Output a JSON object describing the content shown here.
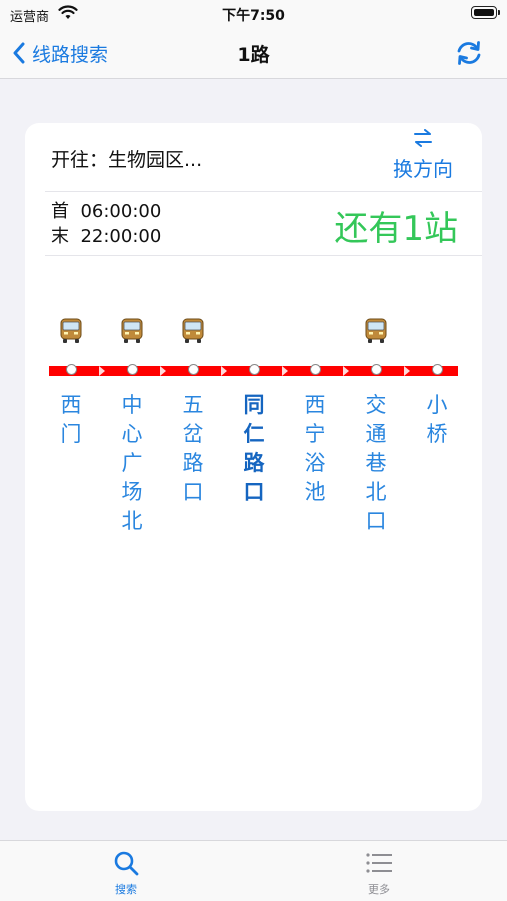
{
  "status_bar": {
    "carrier": "运营商",
    "time": "下午7:50"
  },
  "nav": {
    "back_label": "线路搜索",
    "title": "1路"
  },
  "card": {
    "destination": "开往：生物园区...",
    "switch_label": "换方向",
    "first_bus": "首  06:00:00",
    "last_bus": "末  22:00:00",
    "remaining": "还有1站"
  },
  "route": {
    "stops": [
      {
        "name": "西门",
        "chars": [
          "西",
          "门"
        ],
        "current": false,
        "bus": true
      },
      {
        "name": "中心广场北",
        "chars": [
          "中",
          "心",
          "广",
          "场",
          "北"
        ],
        "current": false,
        "bus": true
      },
      {
        "name": "五岔路口",
        "chars": [
          "五",
          "岔",
          "路",
          "口"
        ],
        "current": false,
        "bus": true
      },
      {
        "name": "同仁路口",
        "chars": [
          "同",
          "仁",
          "路",
          "口"
        ],
        "current": true,
        "bus": false
      },
      {
        "name": "西宁浴池",
        "chars": [
          "西",
          "宁",
          "浴",
          "池"
        ],
        "current": false,
        "bus": false
      },
      {
        "name": "交通巷北口",
        "chars": [
          "交",
          "通",
          "巷",
          "北",
          "口"
        ],
        "current": false,
        "bus": true
      },
      {
        "name": "小桥",
        "chars": [
          "小",
          "桥"
        ],
        "current": false,
        "bus": false
      }
    ],
    "line_color": "#ff0000",
    "stop_text_color": "#2a86df",
    "remaining_color": "#34c759"
  },
  "tabs": [
    {
      "label": "搜索",
      "icon": "search-icon",
      "active": true
    },
    {
      "label": "更多",
      "icon": "list-icon",
      "active": false
    }
  ]
}
